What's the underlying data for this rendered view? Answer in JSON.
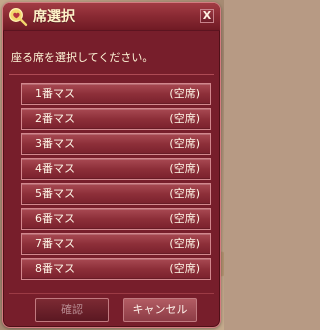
{
  "dialog": {
    "title": "席選択",
    "close_label": "X",
    "instruction": "座る席を選択してください。",
    "slots": [
      {
        "label": "1番マス",
        "status": "(空席)"
      },
      {
        "label": "2番マス",
        "status": "(空席)"
      },
      {
        "label": "3番マス",
        "status": "(空席)"
      },
      {
        "label": "4番マス",
        "status": "(空席)"
      },
      {
        "label": "5番マス",
        "status": "(空席)"
      },
      {
        "label": "6番マス",
        "status": "(空席)"
      },
      {
        "label": "7番マス",
        "status": "(空席)"
      },
      {
        "label": "8番マス",
        "status": "(空席)"
      }
    ],
    "buttons": {
      "confirm": "確認",
      "cancel": "キャンセル"
    }
  }
}
